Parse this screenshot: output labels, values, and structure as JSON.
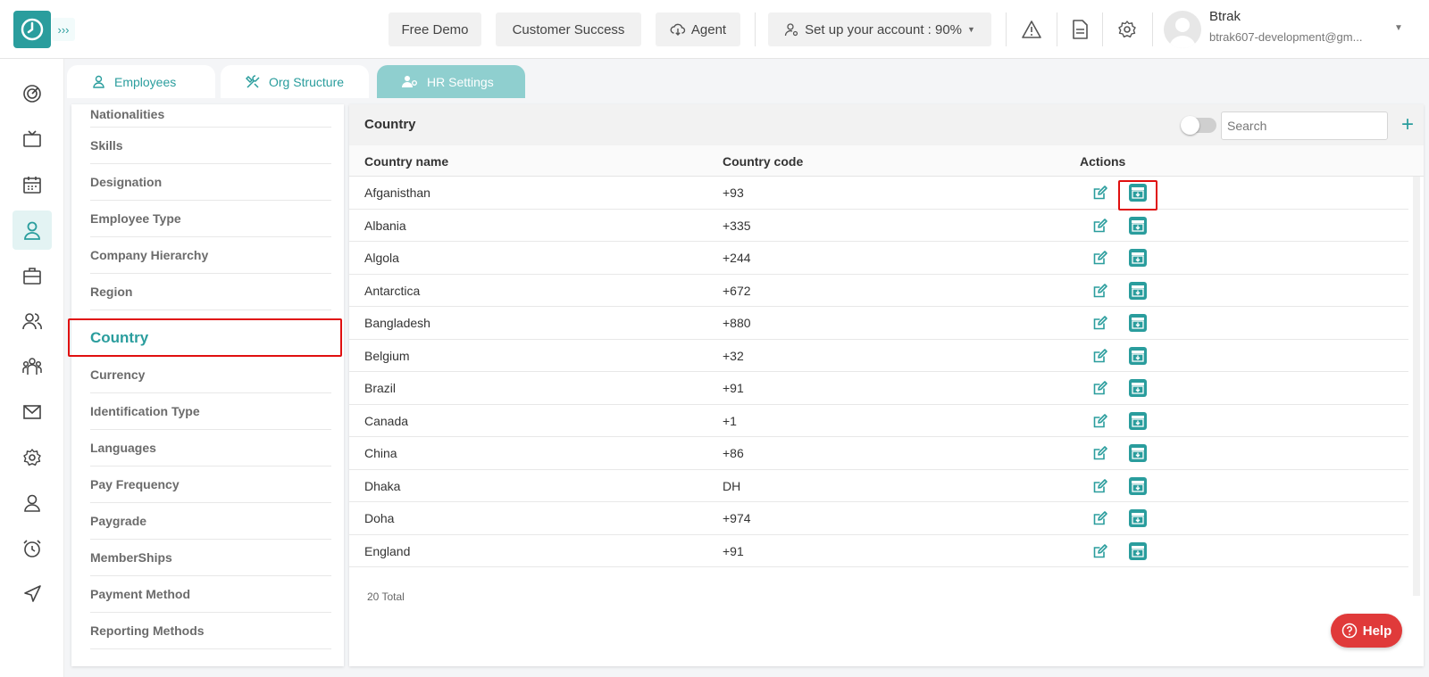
{
  "header": {
    "free_demo": "Free Demo",
    "customer_success": "Customer Success",
    "agent": "Agent",
    "setup": "Set up your account : 90%",
    "user_name": "Btrak",
    "user_email": "btrak607-development@gm..."
  },
  "tabs": [
    {
      "label": "Employees",
      "icon": "person-icon"
    },
    {
      "label": "Org Structure",
      "icon": "tools-icon"
    },
    {
      "label": "HR Settings",
      "icon": "people-settings-icon"
    }
  ],
  "sidebar": {
    "items": [
      {
        "label": "Nationalities"
      },
      {
        "label": "Skills"
      },
      {
        "label": "Designation"
      },
      {
        "label": "Employee Type"
      },
      {
        "label": "Company Hierarchy"
      },
      {
        "label": "Region"
      },
      {
        "label": "Country"
      },
      {
        "label": "Currency"
      },
      {
        "label": "Identification Type"
      },
      {
        "label": "Languages"
      },
      {
        "label": "Pay Frequency"
      },
      {
        "label": "Paygrade"
      },
      {
        "label": "MemberShips"
      },
      {
        "label": "Payment Method"
      },
      {
        "label": "Reporting Methods"
      }
    ],
    "selected": "Country"
  },
  "panel": {
    "title": "Country",
    "search_placeholder": "Search",
    "columns": {
      "name": "Country name",
      "code": "Country code",
      "actions": "Actions"
    },
    "rows": [
      {
        "name": "Afganisthan",
        "code": "+93"
      },
      {
        "name": "Albania",
        "code": "+335"
      },
      {
        "name": "Algola",
        "code": "+244"
      },
      {
        "name": "Antarctica",
        "code": "+672"
      },
      {
        "name": "Bangladesh",
        "code": "+880"
      },
      {
        "name": "Belgium",
        "code": "+32"
      },
      {
        "name": "Brazil",
        "code": "+91"
      },
      {
        "name": "Canada",
        "code": "+1"
      },
      {
        "name": "China",
        "code": "+86"
      },
      {
        "name": "Dhaka",
        "code": "DH"
      },
      {
        "name": "Doha",
        "code": "+974"
      },
      {
        "name": "England",
        "code": "+91"
      }
    ],
    "total": "20 Total"
  },
  "help": "Help",
  "colors": {
    "accent": "#2a9d9d",
    "highlight": "#e01010",
    "help": "#e03a3a"
  }
}
